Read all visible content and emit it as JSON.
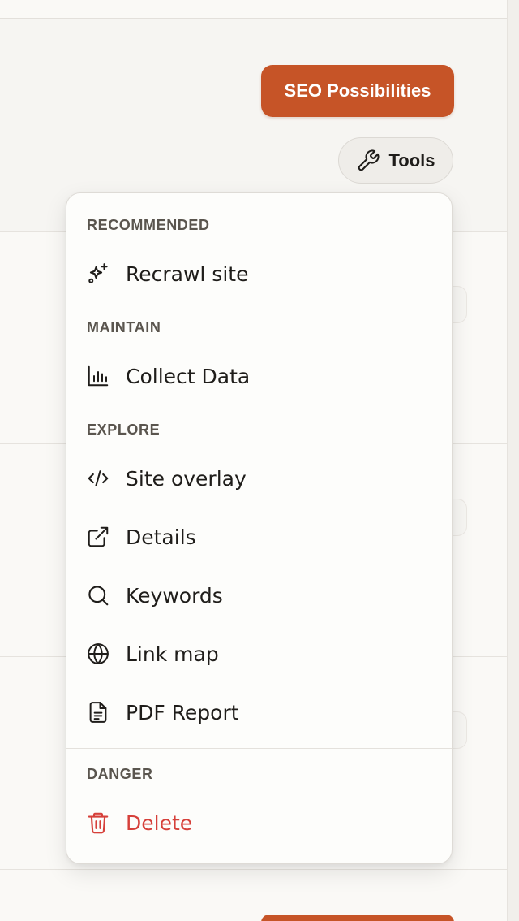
{
  "toolbar": {
    "seo_button_label": "SEO Possibilities",
    "tools_button_label": "Tools",
    "tools_icon": "wrench-icon"
  },
  "menu": {
    "sections": [
      {
        "label": "RECOMMENDED",
        "items": [
          {
            "label": "Recrawl site",
            "icon": "sparkles-icon"
          }
        ]
      },
      {
        "label": "MAINTAIN",
        "items": [
          {
            "label": "Collect Data",
            "icon": "bar-chart-icon"
          }
        ]
      },
      {
        "label": "EXPLORE",
        "items": [
          {
            "label": "Site overlay",
            "icon": "code-icon"
          },
          {
            "label": "Details",
            "icon": "external-link-icon"
          },
          {
            "label": "Keywords",
            "icon": "search-icon"
          },
          {
            "label": "Link map",
            "icon": "globe-icon"
          },
          {
            "label": "PDF Report",
            "icon": "document-icon"
          }
        ]
      },
      {
        "label": "DANGER",
        "items": [
          {
            "label": "Delete",
            "icon": "trash-icon"
          }
        ]
      }
    ]
  },
  "colors": {
    "accent": "#c65427",
    "danger": "#d6403a",
    "section_label": "#5a554e",
    "text": "#1f1d1a"
  }
}
